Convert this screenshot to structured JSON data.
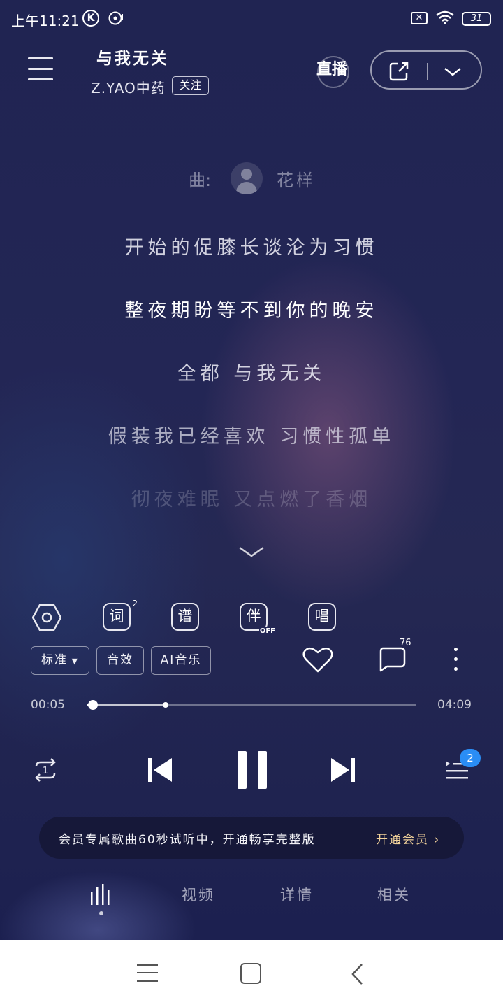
{
  "status_bar": {
    "time": "上午11:21",
    "k_badge": "K",
    "x_badge": "✕",
    "battery": "31"
  },
  "header": {
    "song_title": "与我无关",
    "artist": "Z.YAO中药",
    "follow_label": "关注",
    "live_label": "直播"
  },
  "lyrics": {
    "composer_label": "曲:",
    "composer_name": "花样",
    "lines": [
      "开始的促膝长谈沦为习惯",
      "整夜期盼等不到你的晚安",
      "全都 与我无关",
      "假装我已经喜欢 习惯性孤单",
      "彻夜难眠 又点燃了香烟"
    ]
  },
  "tools": {
    "lyrics_icon": "词",
    "lyrics_count": "2",
    "score_icon": "谱",
    "accompany_icon": "伴",
    "accompany_state": "OFF",
    "sing_icon": "唱"
  },
  "options": {
    "quality_label": "标准",
    "effects_label": "音效",
    "ai_label": "AI音乐",
    "comment_count": "76"
  },
  "progress": {
    "current": "00:05",
    "total": "04:09",
    "played_fraction": 0.02,
    "buffered_fraction": 0.24
  },
  "controls": {
    "repeat_badge": "1",
    "playlist_count": "2"
  },
  "vip_banner": {
    "text": "会员专属歌曲60秒试听中，开通畅享完整版",
    "cta": "开通会员 ›"
  },
  "tabs": {
    "video": "视频",
    "details": "详情",
    "related": "相关"
  },
  "colors": {
    "background": "#232655",
    "vip_cta": "#f1d19a",
    "badge": "#2a8df5"
  }
}
